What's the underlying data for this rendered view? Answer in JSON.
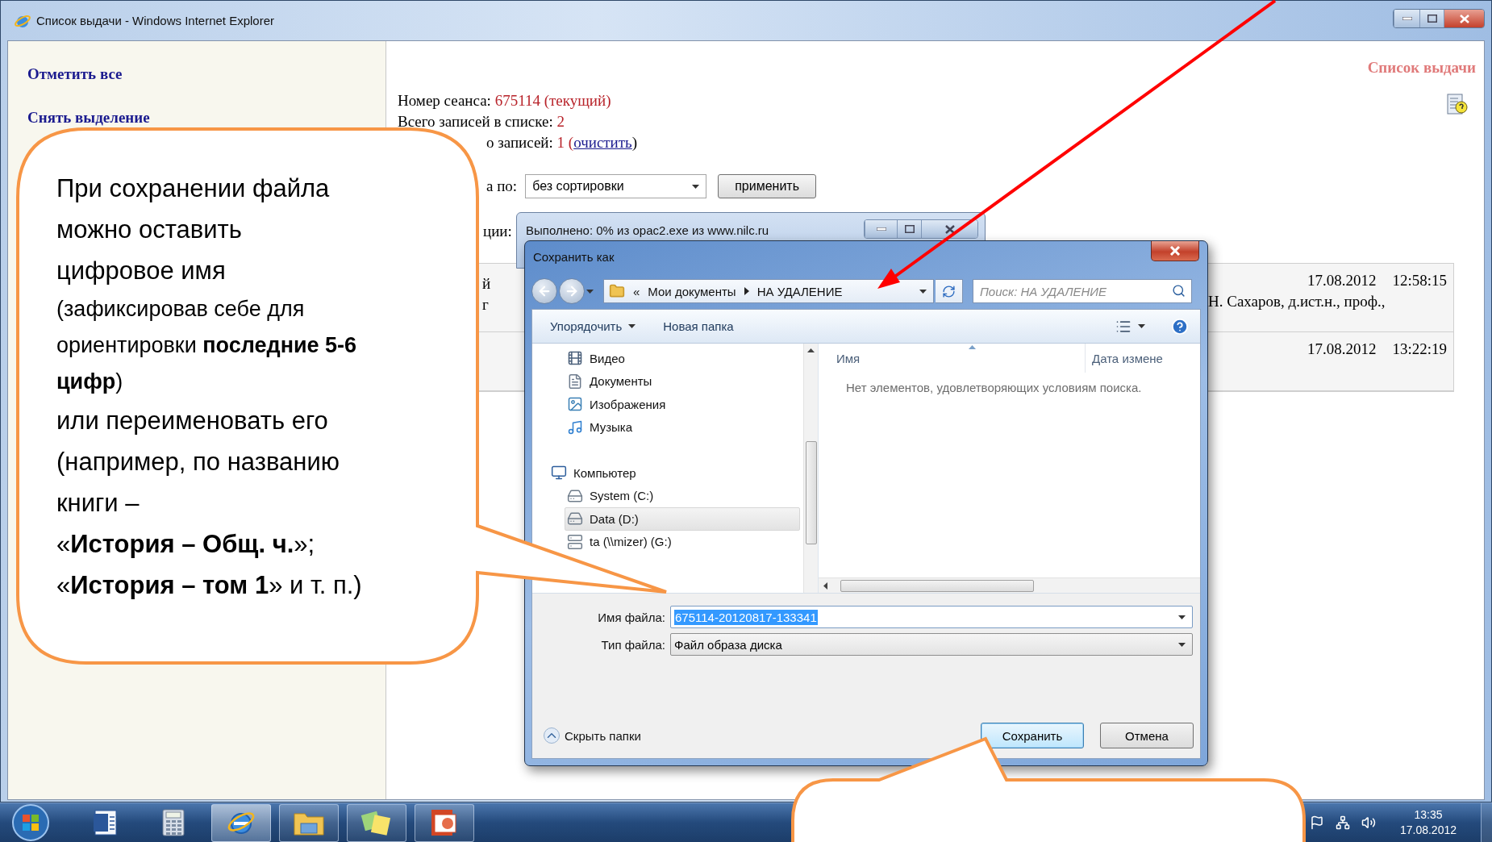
{
  "browser_window": {
    "title": "Список выдачи - Windows Internet Explorer"
  },
  "sidebar": {
    "links": [
      "Отметить все",
      "Снять выделение"
    ]
  },
  "page": {
    "heading": "Список выдачи",
    "info_lines": [
      {
        "label": "Номер сеанса:",
        "value": "675114 (текущий)"
      },
      {
        "label": "Всего записей в списке:",
        "value": "2"
      },
      {
        "label": "о записей:",
        "value": "1 (",
        "link": "очистить",
        "after": ")"
      }
    ],
    "sort": {
      "label": "а по:",
      "value": "без сортировки",
      "button": "применить"
    },
    "section_label": "ции:",
    "rows": [
      {
        "column_1": [
          "й",
          "г"
        ],
        "author": "Н. Сахаров, д.ист.н., проф.,",
        "date": "17.08.2012",
        "time": "12:58:15"
      },
      {
        "date": "17.08.2012",
        "time": "13:22:19"
      }
    ]
  },
  "progress_window": {
    "title": "Выполнено: 0% из opac2.exe из www.nilc.ru"
  },
  "save_dialog": {
    "title": "Сохранить как",
    "path_overflow": "«",
    "path": [
      "Мои документы",
      "НА УДАЛЕНИЕ"
    ],
    "search_placeholder": "Поиск: НА УДАЛЕНИЕ",
    "toolbar": [
      "Упорядочить",
      "Новая папка"
    ],
    "libraries": [
      {
        "label": "Видео",
        "kind": "video",
        "selected": false
      },
      {
        "label": "Документы",
        "kind": "documents",
        "selected": false
      },
      {
        "label": "Изображения",
        "kind": "pictures",
        "selected": false
      },
      {
        "label": "Музыка",
        "kind": "music",
        "selected": false
      }
    ],
    "computer": {
      "label": "Компьютер",
      "kind": "computer",
      "selected": false,
      "children": [
        {
          "label": "System (C:)",
          "kind": "system_drive",
          "selected": false
        },
        {
          "label": "Data (D:)",
          "kind": "drive",
          "selected": true
        },
        {
          "label": "ta (\\\\mizer) (G:)",
          "kind": "network_drive",
          "selected": false
        }
      ]
    },
    "file_list": {
      "columns": [
        "Имя",
        "Дата измене"
      ],
      "empty_message": "Нет элементов, удовлетворяющих условиям поиска."
    },
    "filename": {
      "label": "Имя файла:",
      "value": "675114-20120817-133341",
      "highlighted": true
    },
    "filetype": {
      "label": "Тип файла:",
      "value": "Файл образа диска"
    },
    "hide_folders": "Скрыть папки",
    "buttons": [
      {
        "label": "Сохранить",
        "default": true
      },
      {
        "label": "Отмена",
        "default": false
      }
    ]
  },
  "taskbar": {
    "apps": [
      {
        "kind": "word",
        "running": false,
        "active": false
      },
      {
        "kind": "calculator",
        "running": false,
        "active": false
      },
      {
        "kind": "browser",
        "running": true,
        "active": true
      },
      {
        "kind": "explorer",
        "running": true,
        "active": false
      },
      {
        "kind": "notes",
        "running": true,
        "active": false
      },
      {
        "kind": "presentation",
        "running": true,
        "active": false
      }
    ],
    "clock": {
      "time": "13:35",
      "date": "17.08.2012"
    }
  },
  "callout": {
    "paragraphs": [
      {
        "kind": "main",
        "lines": [
          "При сохранении файла",
          "можно оставить",
          "цифровое имя"
        ]
      },
      {
        "kind": "note",
        "lines": [
          "(зафиксировав себе для",
          "ориентировки **последние 5-6**",
          "**цифр**)"
        ]
      },
      {
        "kind": "main",
        "lines": [
          "или переименовать его",
          "(например, по названию",
          "книги –",
          "«**История – Общ. ч.**»;",
          "«**История – том 1**» и т. п.)"
        ]
      }
    ]
  }
}
